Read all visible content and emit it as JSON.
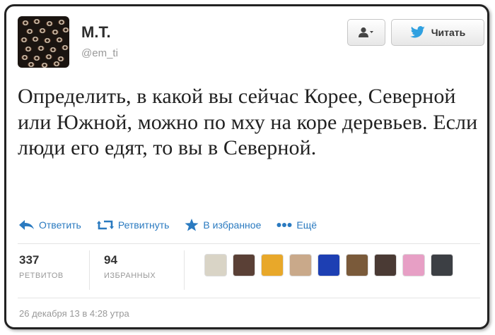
{
  "user": {
    "name": "M.T.",
    "handle": "@em_ti"
  },
  "buttons": {
    "follow_label": "Читать"
  },
  "tweet": {
    "text": "Определить, в какой вы сейчас Корее, Северной или Южной, можно по мху на коре деревьев. Если люди его едят, то вы в Северной."
  },
  "actions": [
    {
      "label": "Ответить",
      "icon": "reply-icon"
    },
    {
      "label": "Ретвитнуть",
      "icon": "retweet-icon"
    },
    {
      "label": "В избранное",
      "icon": "star-icon"
    },
    {
      "label": "Ещё",
      "icon": "more-icon"
    }
  ],
  "stats": {
    "retweets": {
      "value": "337",
      "label": "РЕТВИТОВ"
    },
    "favorites": {
      "value": "94",
      "label": "ИЗБРАННЫХ"
    }
  },
  "faces": [
    {
      "name": "avatar-1",
      "color": "#d9d4c6"
    },
    {
      "name": "avatar-2",
      "color": "#5a4036"
    },
    {
      "name": "avatar-3",
      "color": "#e8a82a"
    },
    {
      "name": "avatar-4",
      "color": "#c9a98a"
    },
    {
      "name": "avatar-5",
      "color": "#1d3fb3"
    },
    {
      "name": "avatar-6",
      "color": "#7a5a3a"
    },
    {
      "name": "avatar-7",
      "color": "#4a3a34"
    },
    {
      "name": "avatar-8",
      "color": "#e79fc5"
    },
    {
      "name": "avatar-9",
      "color": "#3c3f44"
    }
  ],
  "timestamp": "26 декабря 13 в 4:28 утра",
  "colors": {
    "link": "#2a7ac0",
    "twitter_bird": "#2fa0e0"
  }
}
